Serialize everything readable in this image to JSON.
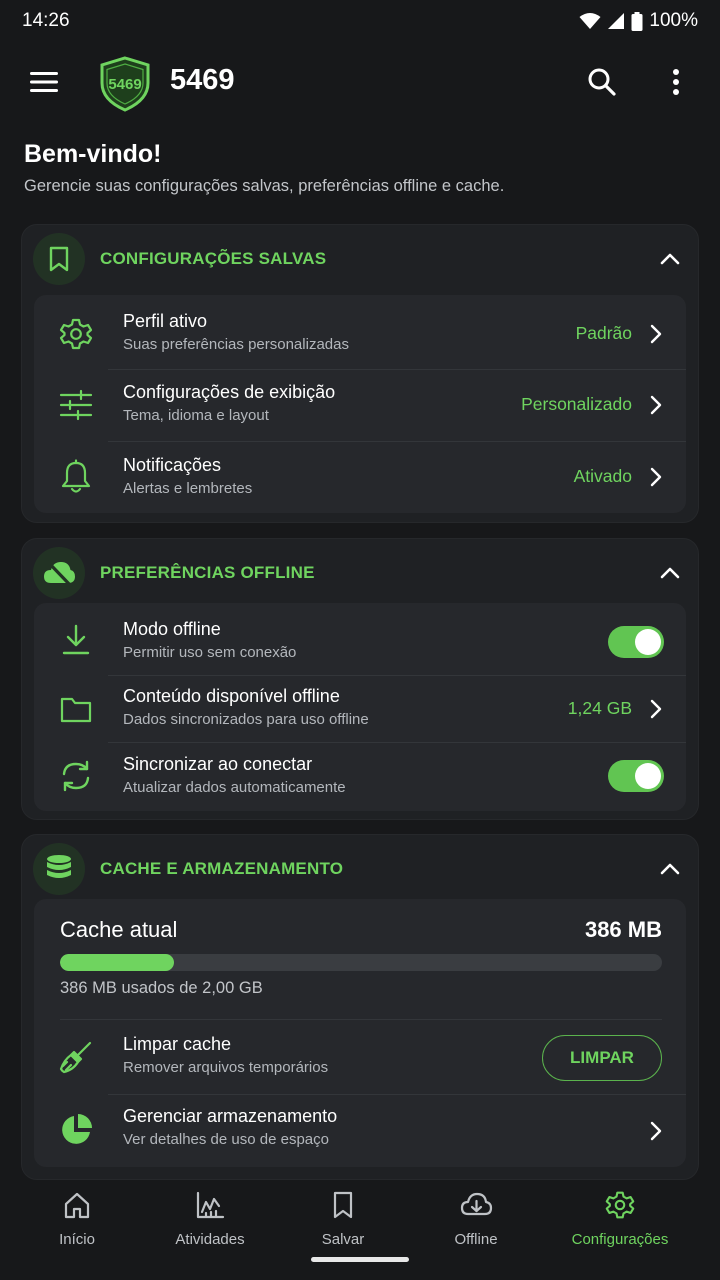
{
  "status_bar": {
    "time": "14:26",
    "battery": "100%"
  },
  "app_bar": {
    "logo_text": "5469",
    "title": "5469"
  },
  "welcome": {
    "title": "Bem-vindo!",
    "subtitle": "Gerencie suas configurações salvas, preferências offline e cache."
  },
  "saved_settings": {
    "title": "CONFIGURAÇÕES SALVAS",
    "rows": [
      {
        "icon": "gear-icon",
        "title": "Perfil ativo",
        "subtitle": "Suas preferências personalizadas",
        "value": "Padrão"
      },
      {
        "icon": "sliders-icon",
        "title": "Configurações de exibição",
        "subtitle": "Tema, idioma e layout",
        "value": "Personalizado"
      },
      {
        "icon": "bell-icon",
        "title": "Notificações",
        "subtitle": "Alertas e lembretes",
        "value": "Ativado"
      }
    ]
  },
  "offline_prefs": {
    "title": "PREFERÊNCIAS OFFLINE",
    "rows": [
      {
        "icon": "download-icon",
        "title": "Modo offline",
        "subtitle": "Permitir uso sem conexão",
        "toggle_on": true
      },
      {
        "icon": "folder-icon",
        "title": "Conteúdo disponível offline",
        "subtitle": "Dados sincronizados para uso offline",
        "value": "1,24 GB"
      },
      {
        "icon": "sync-icon",
        "title": "Sincronizar ao conectar",
        "subtitle": "Atualizar dados automaticamente",
        "toggle_on": true
      }
    ]
  },
  "cache": {
    "title": "CACHE E ARMAZENAMENTO",
    "current_label": "Cache atual",
    "current_size": "386 MB",
    "usage_fraction": 0.19,
    "usage_text": "386 MB usados de 2,00 GB",
    "clear": {
      "title": "Limpar cache",
      "subtitle": "Remover arquivos temporários",
      "button": "LIMPAR"
    },
    "manage": {
      "title": "Gerenciar armazenamento",
      "subtitle": "Ver detalhes de uso de espaço"
    }
  },
  "bottom_nav": [
    {
      "label": "Início",
      "icon": "home-icon",
      "active": false
    },
    {
      "label": "Atividades",
      "icon": "activity-chart-icon",
      "active": false
    },
    {
      "label": "Salvar",
      "icon": "bookmark-icon",
      "active": false
    },
    {
      "label": "Offline",
      "icon": "cloud-download-icon",
      "active": false
    },
    {
      "label": "Configurações",
      "icon": "settings-icon",
      "active": true
    }
  ],
  "colors": {
    "accent": "#6fd45f",
    "background": "#17181a",
    "card": "#1f2124",
    "inner": "#26282c"
  }
}
